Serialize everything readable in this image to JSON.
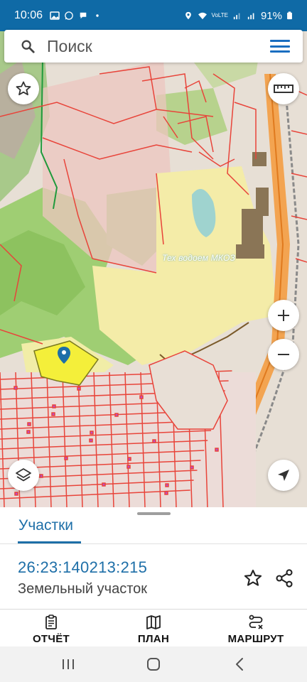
{
  "status_bar": {
    "time": "10:06",
    "battery": "91%",
    "network_label": "VoLTE",
    "icons": [
      "gallery-icon",
      "whatsapp-icon",
      "chat-icon",
      "dot-icon",
      "location-icon",
      "wifi-icon",
      "signal-icon",
      "signal-icon",
      "battery-icon"
    ]
  },
  "search": {
    "placeholder": "Поиск",
    "icon": "search-icon",
    "menu_icon": "hamburger-menu-icon"
  },
  "map": {
    "label": "Тех водоем МКОЗ",
    "controls": [
      "favorite-star-icon",
      "ruler-icon",
      "zoom-in-icon",
      "zoom-out-icon",
      "layers-icon",
      "navigation-arrow-icon"
    ],
    "colors": {
      "parcel_border": "#e8443a",
      "selected_parcel": "#f3ef3b",
      "forest": "#9ccc6e",
      "road": "#f08a24"
    }
  },
  "sheet": {
    "tab_label": "Участки",
    "parcel_id": "26:23:140213:215",
    "parcel_type": "Земельный участок",
    "actions": [
      {
        "label": "ОТЧЁТ",
        "icon": "clipboard-icon"
      },
      {
        "label": "ПЛАН",
        "icon": "map-icon"
      },
      {
        "label": "МАРШРУТ",
        "icon": "route-icon"
      }
    ],
    "accent": "#1e6fa8"
  },
  "nav_bar": {
    "buttons": [
      "recent-apps-icon",
      "home-icon",
      "back-icon"
    ]
  }
}
